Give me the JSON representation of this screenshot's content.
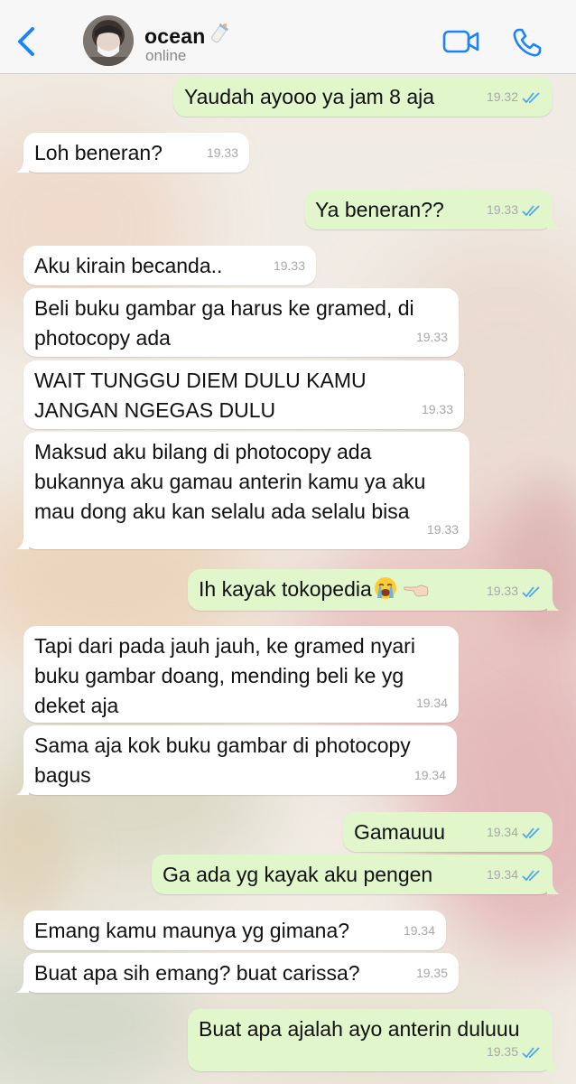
{
  "header": {
    "contact_name": "ocean",
    "status": "online",
    "icons": [
      "back-icon",
      "video-call-icon",
      "voice-call-icon",
      "baby-bottle-emoji"
    ]
  },
  "colors": {
    "accent": "#1a84ff",
    "incoming_bubble": "#ffffff",
    "outgoing_bubble": "#e1f6cb",
    "read_ticks": "#4fa6ee",
    "timestamp": "#a8a8a8"
  },
  "messages": [
    {
      "dir": "out",
      "text": "Yaudah ayooo ya jam 8 aja",
      "time": "19.32",
      "read": true
    },
    {
      "dir": "in",
      "text": "Loh beneran?",
      "time": "19.33"
    },
    {
      "dir": "out",
      "text": "Ya beneran??",
      "time": "19.33",
      "read": true
    },
    {
      "dir": "in",
      "text": "Aku kirain becanda..",
      "time": "19.33"
    },
    {
      "dir": "in",
      "text": "Beli buku gambar ga harus ke gramed, di\nphotocopy ada",
      "time": "19.33"
    },
    {
      "dir": "in",
      "text": "WAIT TUNGGU DIEM DULU KAMU\nJANGAN NGEGAS DULU",
      "time": "19.33"
    },
    {
      "dir": "in",
      "text": "Maksud aku bilang di photocopy ada\nbukannya aku gamau anterin kamu ya aku\nmau dong aku kan selalu ada selalu bisa",
      "time": "19.33"
    },
    {
      "dir": "out",
      "text": "Ih kayak tokopedia",
      "emojis": [
        "loudly-crying-face-emoji",
        "backhand-index-pointing-left-emoji"
      ],
      "time": "19.33",
      "read": true
    },
    {
      "dir": "in",
      "text": "Tapi dari pada jauh jauh, ke gramed nyari\nbuku gambar doang, mending beli ke yg\ndeket aja",
      "time": "19.34"
    },
    {
      "dir": "in",
      "text": "Sama aja kok buku gambar di photocopy\nbagus",
      "time": "19.34"
    },
    {
      "dir": "out",
      "text": "Gamauuu",
      "time": "19.34",
      "read": true
    },
    {
      "dir": "out",
      "text": "Ga ada yg kayak aku pengen",
      "time": "19.34",
      "read": true
    },
    {
      "dir": "in",
      "text": "Emang kamu maunya yg gimana?",
      "time": "19.34"
    },
    {
      "dir": "in",
      "text": "Buat apa sih emang? buat carissa?",
      "time": "19.35"
    },
    {
      "dir": "out",
      "text": "Buat apa ajalah ayo anterin duluuu",
      "time": "19.35",
      "read": true
    }
  ]
}
